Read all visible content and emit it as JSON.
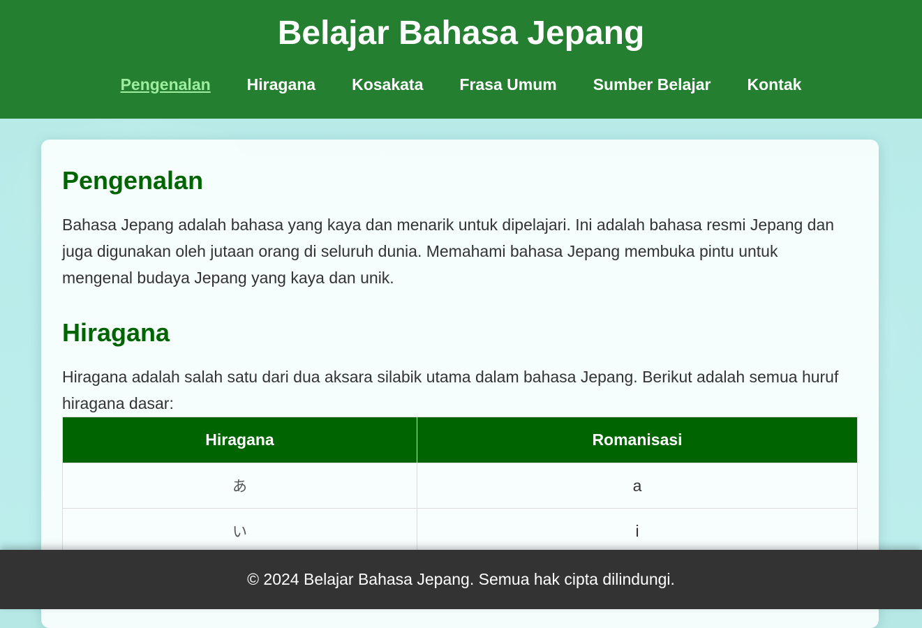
{
  "header": {
    "title": "Belajar Bahasa Jepang",
    "nav": [
      {
        "label": "Pengenalan",
        "active": true
      },
      {
        "label": "Hiragana",
        "active": false
      },
      {
        "label": "Kosakata",
        "active": false
      },
      {
        "label": "Frasa Umum",
        "active": false
      },
      {
        "label": "Sumber Belajar",
        "active": false
      },
      {
        "label": "Kontak",
        "active": false
      }
    ]
  },
  "intro": {
    "heading": "Pengenalan",
    "text": "Bahasa Jepang adalah bahasa yang kaya dan menarik untuk dipelajari. Ini adalah bahasa resmi Jepang dan juga digunakan oleh jutaan orang di seluruh dunia. Memahami bahasa Jepang membuka pintu untuk mengenal budaya Jepang yang kaya dan unik."
  },
  "hiragana": {
    "heading": "Hiragana",
    "text": "Hiragana adalah salah satu dari dua aksara silabik utama dalam bahasa Jepang. Berikut adalah semua huruf hiragana dasar:",
    "table": {
      "headers": [
        "Hiragana",
        "Romanisasi"
      ],
      "rows": [
        [
          "あ",
          "a"
        ],
        [
          "い",
          "i"
        ]
      ]
    }
  },
  "footer": {
    "text": "© 2024 Belajar Bahasa Jepang. Semua hak cipta dilindungi."
  },
  "colors": {
    "header_bg": "#247f31",
    "heading_green": "#006400",
    "active_nav": "#9fee9f",
    "footer_bg": "#333333"
  }
}
